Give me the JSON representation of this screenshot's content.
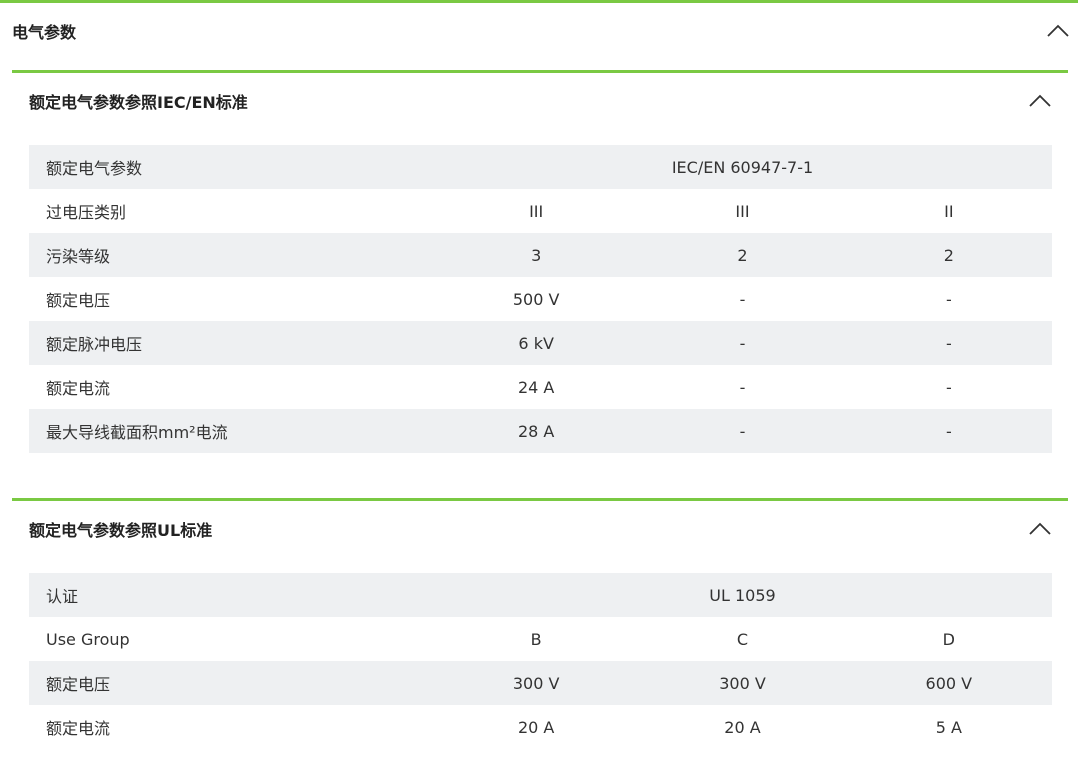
{
  "main": {
    "title": "电气参数"
  },
  "sections": [
    {
      "title": "额定电气参数参照IEC/EN标准",
      "standard_row": {
        "label": "额定电气参数",
        "value": "IEC/EN 60947-7-1"
      },
      "rows": [
        {
          "label": "过电压类别",
          "values": [
            "III",
            "III",
            "II"
          ]
        },
        {
          "label": "污染等级",
          "values": [
            "3",
            "2",
            "2"
          ]
        },
        {
          "label": "额定电压",
          "values": [
            "500 V",
            "-",
            "-"
          ]
        },
        {
          "label": "额定脉冲电压",
          "values": [
            "6 kV",
            "-",
            "-"
          ]
        },
        {
          "label": "额定电流",
          "values": [
            "24 A",
            "-",
            "-"
          ]
        },
        {
          "label": "最大导线截面积mm²电流",
          "values": [
            "28 A",
            "-",
            "-"
          ]
        }
      ]
    },
    {
      "title": "额定电气参数参照UL标准",
      "standard_row": {
        "label": "认证",
        "value": "UL 1059"
      },
      "rows": [
        {
          "label": "Use Group",
          "values": [
            "B",
            "C",
            "D"
          ]
        },
        {
          "label": "额定电压",
          "values": [
            "300 V",
            "300 V",
            "600 V"
          ]
        },
        {
          "label": "额定电流",
          "values": [
            "20 A",
            "20 A",
            "5 A"
          ]
        }
      ]
    }
  ],
  "icons": {
    "collapse": "chevron-up-icon"
  },
  "colors": {
    "accent": "#7ac943",
    "row_shade": "#eef0f2",
    "text": "#333333"
  }
}
